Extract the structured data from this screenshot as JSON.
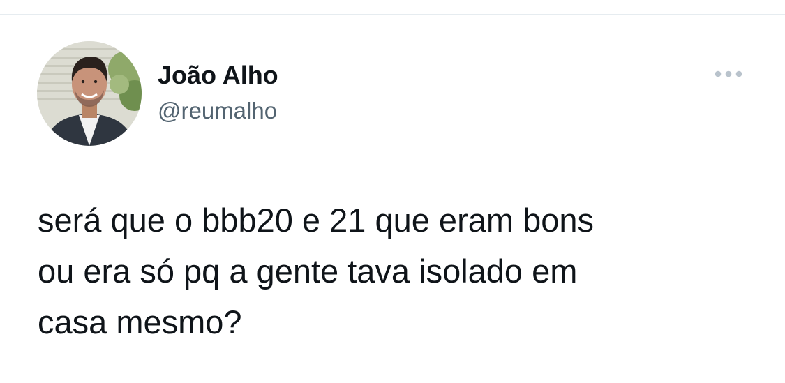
{
  "tweet": {
    "author": {
      "display_name": "João Alho",
      "handle": "@reumalho",
      "avatar_icon": "profile-photo"
    },
    "more_icon": "ellipsis-icon",
    "text": "será que o bbb20 e 21 que eram bons\nou era só pq a gente tava isolado em\ncasa mesmo?"
  },
  "colors": {
    "text": "#0f1419",
    "secondary_text": "#536471",
    "divider": "#e6ecf0",
    "icon": "#b9c3cc"
  }
}
